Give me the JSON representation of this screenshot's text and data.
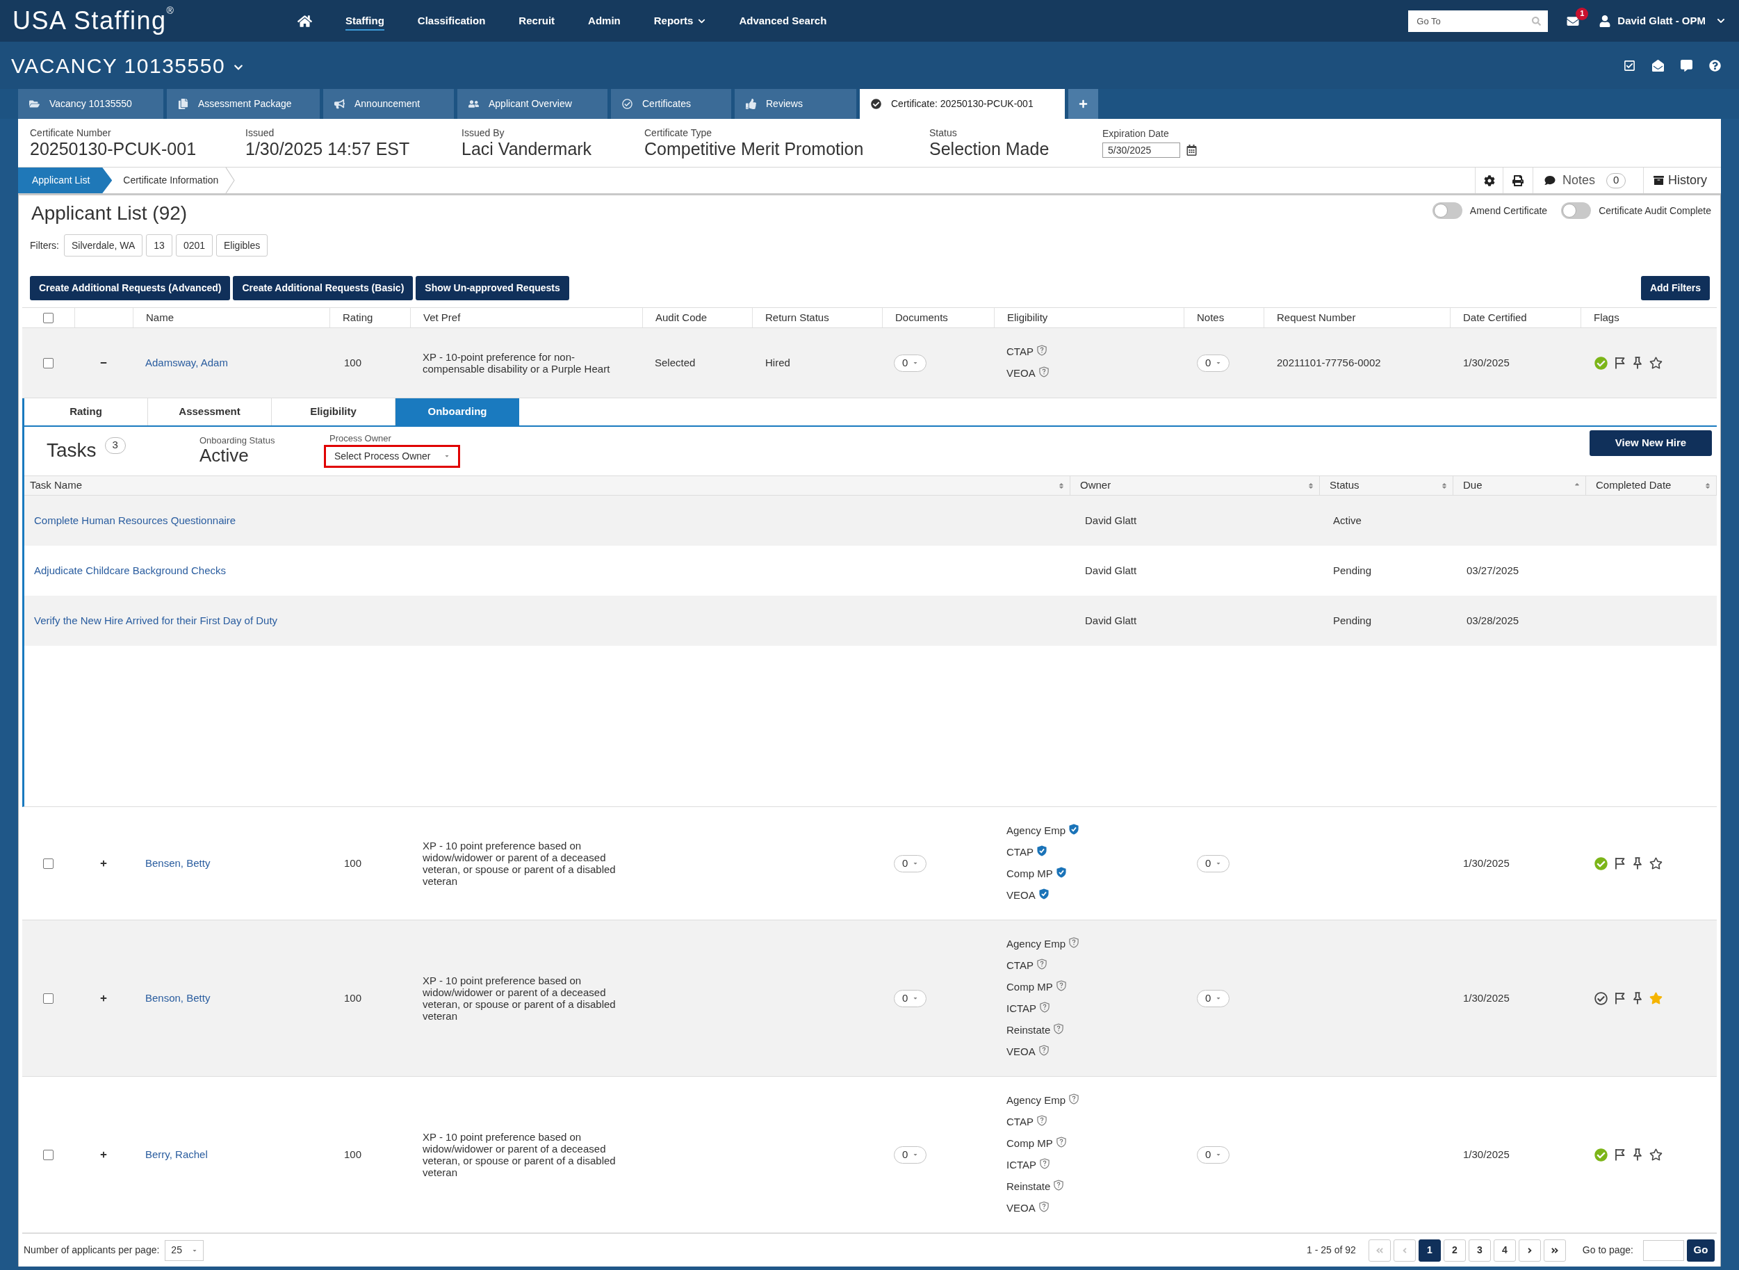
{
  "top_nav": {
    "logo": "USA Staffing$^{®}$",
    "items": [
      {
        "label": "Staffing",
        "selected": true,
        "has_menu": false
      },
      {
        "label": "Classification",
        "selected": false,
        "has_menu": false
      },
      {
        "label": "Recruit",
        "selected": false,
        "has_menu": false
      },
      {
        "label": "Admin",
        "selected": false,
        "has_menu": false
      },
      {
        "label": "Reports",
        "selected": false,
        "has_menu": true
      },
      {
        "label": "Advanced Search",
        "selected": false,
        "has_menu": false
      }
    ],
    "go_to": {
      "placeholder": "Go To"
    },
    "messages_badge": "1",
    "user": "David Glatt - OPM"
  },
  "vacancy": {
    "title": "VACANCY 10135550"
  },
  "tabs": [
    {
      "label": "Vacancy 10135550",
      "selected": false
    },
    {
      "label": "Assessment Package",
      "selected": false
    },
    {
      "label": "Announcement",
      "selected": false
    },
    {
      "label": "Applicant Overview",
      "selected": false
    },
    {
      "label": "Certificates",
      "selected": false
    },
    {
      "label": "Reviews",
      "selected": false
    },
    {
      "label": "Certificate: 20250130-PCUK-001",
      "selected": true
    }
  ],
  "certificate": {
    "fields": [
      {
        "label": "Certificate Number",
        "value": "20250130-PCUK-001"
      },
      {
        "label": "Issued",
        "value": "1/30/2025 14:57 EST"
      },
      {
        "label": "Issued By",
        "value": "Laci Vandermark"
      },
      {
        "label": "Certificate Type",
        "value": "Competitive Merit Promotion"
      },
      {
        "label": "Status",
        "value": "Selection Made"
      }
    ],
    "expiration": {
      "label": "Expiration Date",
      "value": "5/30/2025"
    }
  },
  "breadcrumbs": [
    {
      "label": "Applicant List",
      "selected": true
    },
    {
      "label": "Certificate Information",
      "selected": false
    }
  ],
  "toolbar": {
    "notes": "Notes",
    "notes_count": "0",
    "history": "History"
  },
  "applicant_list": {
    "title": "Applicant List (92)",
    "toggles": [
      {
        "label": "Amend Certificate",
        "on": false
      },
      {
        "label": "Certificate Audit Complete",
        "on": false
      }
    ],
    "filters_label": "Filters:",
    "filters": [
      "Silverdale, WA",
      "13",
      "0201",
      "Eligibles"
    ],
    "actions": [
      "Create Additional Requests (Advanced)",
      "Create Additional Requests (Basic)",
      "Show Un-approved Requests"
    ],
    "add_filters": "Add Filters"
  },
  "table": {
    "select_all_checked": false,
    "columns": [
      "Name",
      "Rating",
      "Vet Pref",
      "Audit Code",
      "Return Status",
      "Documents",
      "Eligibility",
      "Notes",
      "Request Number",
      "Date Certified",
      "Flags"
    ],
    "rows": [
      {
        "checked": false,
        "expanded": true,
        "name": "Adamsway, Adam",
        "rating": "100",
        "vet_pref": "XP - 10-point preference for non-compensable disability or a Purple Heart",
        "audit_code": "Selected",
        "return_status": "Hired",
        "documents": "0",
        "eligibility": [
          {
            "label": "CTAP",
            "verified": false
          },
          {
            "label": "VEOA",
            "verified": false
          }
        ],
        "notes": "0",
        "request_number": "20211101-77756-0002",
        "date_certified": "1/30/2025",
        "flags": {
          "checked": true,
          "starred": false
        },
        "detail": {
          "tabs": [
            {
              "label": "Rating",
              "selected": false
            },
            {
              "label": "Assessment",
              "selected": false
            },
            {
              "label": "Eligibility",
              "selected": false
            },
            {
              "label": "Onboarding",
              "selected": true
            }
          ],
          "tasks_title": "Tasks",
          "tasks_count": "3",
          "onboarding_status": {
            "label": "Onboarding Status",
            "value": "Active"
          },
          "process_owner": {
            "label": "Process Owner",
            "placeholder": "Select Process Owner",
            "highlighted": true
          },
          "view_new_hire": "View New Hire",
          "task_columns": [
            {
              "label": "Task Name",
              "sorted": false
            },
            {
              "label": "Owner",
              "sorted": false
            },
            {
              "label": "Status",
              "sorted": false
            },
            {
              "label": "Due",
              "sorted": true
            },
            {
              "label": "Completed Date",
              "sorted": false
            }
          ],
          "tasks": [
            {
              "name": "Complete Human Resources Questionnaire",
              "owner": "David Glatt",
              "status": "Active"
            },
            {
              "name": "Adjudicate Childcare Background Checks",
              "owner": "David Glatt",
              "status": "Pending",
              "due": "03/27/2025"
            },
            {
              "name": "Verify the New Hire Arrived for their First Day of Duty",
              "owner": "David Glatt",
              "status": "Pending",
              "due": "03/28/2025"
            }
          ]
        }
      },
      {
        "checked": false,
        "expanded": false,
        "name": "Bensen, Betty",
        "rating": "100",
        "vet_pref": "XP - 10 point preference based on widow/widower or parent of a deceased veteran, or spouse or parent of a disabled veteran",
        "documents": "0",
        "eligibility": [
          {
            "label": "Agency Emp",
            "verified": true
          },
          {
            "label": "CTAP",
            "verified": true
          },
          {
            "label": "Comp MP",
            "verified": true
          },
          {
            "label": "VEOA",
            "verified": true
          }
        ],
        "notes": "0",
        "date_certified": "1/30/2025",
        "flags": {
          "checked": true,
          "starred": false
        }
      },
      {
        "checked": false,
        "expanded": false,
        "name": "Benson, Betty",
        "rating": "100",
        "vet_pref": "XP - 10 point preference based on widow/widower or parent of a deceased veteran, or spouse or parent of a disabled veteran",
        "documents": "0",
        "eligibility": [
          {
            "label": "Agency Emp",
            "verified": false
          },
          {
            "label": "CTAP",
            "verified": false
          },
          {
            "label": "Comp MP",
            "verified": false
          },
          {
            "label": "ICTAP",
            "verified": false
          },
          {
            "label": "Reinstate",
            "verified": false
          },
          {
            "label": "VEOA",
            "verified": false
          }
        ],
        "notes": "0",
        "date_certified": "1/30/2025",
        "flags": {
          "checked": false,
          "starred": true
        }
      },
      {
        "checked": false,
        "expanded": false,
        "name": "Berry, Rachel",
        "rating": "100",
        "vet_pref": "XP - 10 point preference based on widow/widower or parent of a deceased veteran, or spouse or parent of a disabled veteran",
        "documents": "0",
        "eligibility": [
          {
            "label": "Agency Emp",
            "verified": false
          },
          {
            "label": "CTAP",
            "verified": false
          },
          {
            "label": "Comp MP",
            "verified": false
          },
          {
            "label": "ICTAP",
            "verified": false
          },
          {
            "label": "Reinstate",
            "verified": false
          },
          {
            "label": "VEOA",
            "verified": false
          }
        ],
        "notes": "0",
        "date_certified": "1/30/2025",
        "flags": {
          "checked": true,
          "starred": false
        }
      }
    ]
  },
  "pagination": {
    "per_page_label": "Number of applicants per page:",
    "per_page": "25",
    "range": "1 - 25 of 92",
    "prev_disabled": true,
    "next_disabled": false,
    "pages": [
      {
        "label": "1",
        "selected": true
      },
      {
        "label": "2",
        "selected": false
      },
      {
        "label": "3",
        "selected": false
      },
      {
        "label": "4",
        "selected": false
      }
    ],
    "go_to_label": "Go to page:",
    "go_button": "Go"
  }
}
